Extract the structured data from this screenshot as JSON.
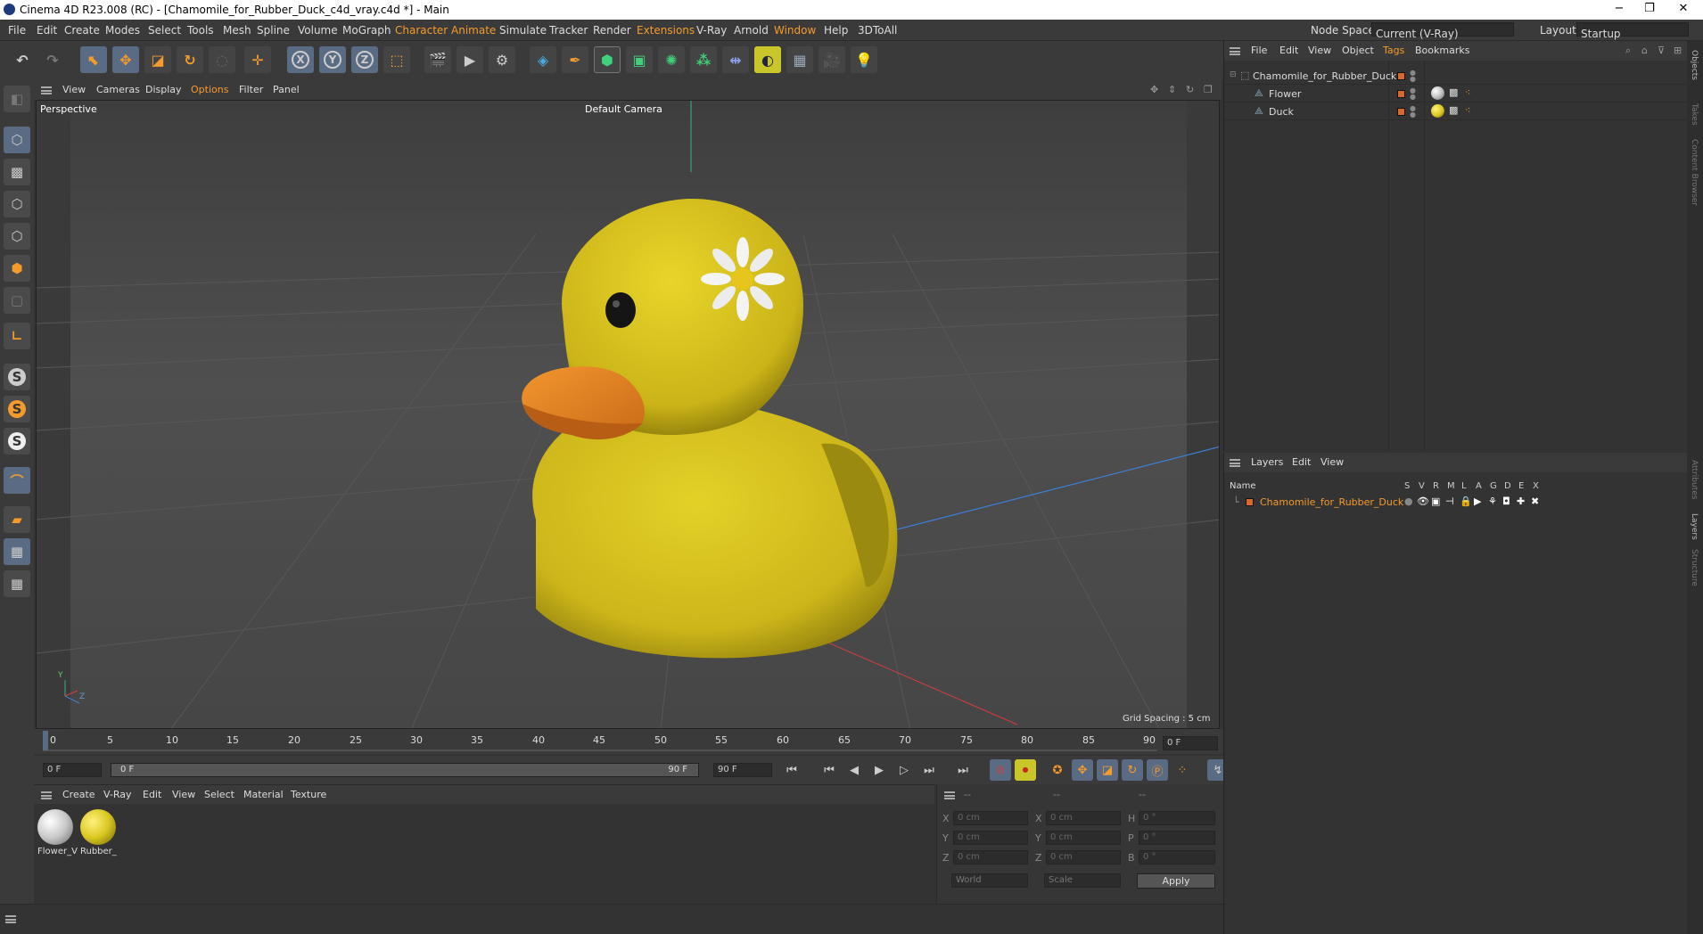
{
  "window": {
    "title": "Cinema 4D R23.008 (RC) - [Chamomile_for_Rubber_Duck_c4d_vray.c4d *] - Main",
    "controls": [
      "−",
      "❐",
      "✕"
    ]
  },
  "menubar": {
    "items": [
      "File",
      "Edit",
      "Create",
      "Modes",
      "Select",
      "Tools",
      "Mesh",
      "Spline",
      "Volume",
      "MoGraph",
      "Character",
      "Animate",
      "Simulate",
      "Tracker",
      "Render",
      "Extensions",
      "V-Ray",
      "Arnold",
      "Window",
      "Help",
      "3DToAll"
    ],
    "node_space_label": "Node Space:",
    "node_space_value": "Current (V-Ray)",
    "layout_label": "Layout:",
    "layout_value": "Startup"
  },
  "toolbar": {
    "undo": "↶",
    "redo": "↷",
    "x_lock": "X",
    "y_lock": "Y",
    "z_lock": "Z"
  },
  "viewport": {
    "menu": [
      "View",
      "Cameras",
      "Display",
      "Options",
      "Filter",
      "Panel"
    ],
    "label": "Perspective",
    "camera": "Default Camera",
    "grid_spacing": "Grid Spacing : 5 cm",
    "axis_y": "Y",
    "axis_z": "Z"
  },
  "timeline": {
    "ticks": [
      "0",
      "5",
      "10",
      "15",
      "20",
      "25",
      "30",
      "35",
      "40",
      "45",
      "50",
      "55",
      "60",
      "65",
      "70",
      "75",
      "80",
      "85",
      "90"
    ],
    "current_frame_right": "0 F"
  },
  "transport": {
    "start_field": "0 F",
    "range_start": "0 F",
    "range_end": "90 F",
    "end_field": "90 F"
  },
  "materials": {
    "menu": [
      "Create",
      "V-Ray",
      "Edit",
      "View",
      "Select",
      "Material",
      "Texture"
    ],
    "items": [
      {
        "label": "Flower_V",
        "color": "#c8c8c8"
      },
      {
        "label": "Rubber_",
        "color": "#d9c620"
      }
    ]
  },
  "coords": {
    "header": [
      "--",
      "--",
      "--"
    ],
    "rows": [
      {
        "a": "X",
        "av": "0 cm",
        "b": "X",
        "bv": "0 cm",
        "c": "H",
        "cv": "0 °"
      },
      {
        "a": "Y",
        "av": "0 cm",
        "b": "Y",
        "bv": "0 cm",
        "c": "P",
        "cv": "0 °"
      },
      {
        "a": "Z",
        "av": "0 cm",
        "b": "Z",
        "bv": "0 cm",
        "c": "B",
        "cv": "0 °"
      }
    ],
    "world": "World",
    "scale": "Scale",
    "apply": "Apply"
  },
  "objects": {
    "menu": [
      "File",
      "Edit",
      "View",
      "Object",
      "Tags",
      "Bookmarks"
    ],
    "tree": [
      {
        "name": "Chamomile_for_Rubber_Duck",
        "indent": 0
      },
      {
        "name": "Flower",
        "indent": 1
      },
      {
        "name": "Duck",
        "indent": 1
      }
    ]
  },
  "layers": {
    "menu": [
      "Layers",
      "Edit",
      "View"
    ],
    "name_header": "Name",
    "col_headers": [
      "S",
      "V",
      "R",
      "M",
      "L",
      "A",
      "G",
      "D",
      "E",
      "X"
    ],
    "items": [
      {
        "name": "Chamomile_for_Rubber_Duck",
        "color": "#d8692a"
      }
    ]
  },
  "right_tabs": [
    "Objects",
    "Takes",
    "Content Browser",
    "Attributes",
    "Layers",
    "Structure"
  ],
  "colors": {
    "accent": "#f59b2b",
    "duck": "#d9c620",
    "beak": "#e8852a",
    "active_tool": "#5a6b84",
    "layer_text": "#e8852a"
  }
}
